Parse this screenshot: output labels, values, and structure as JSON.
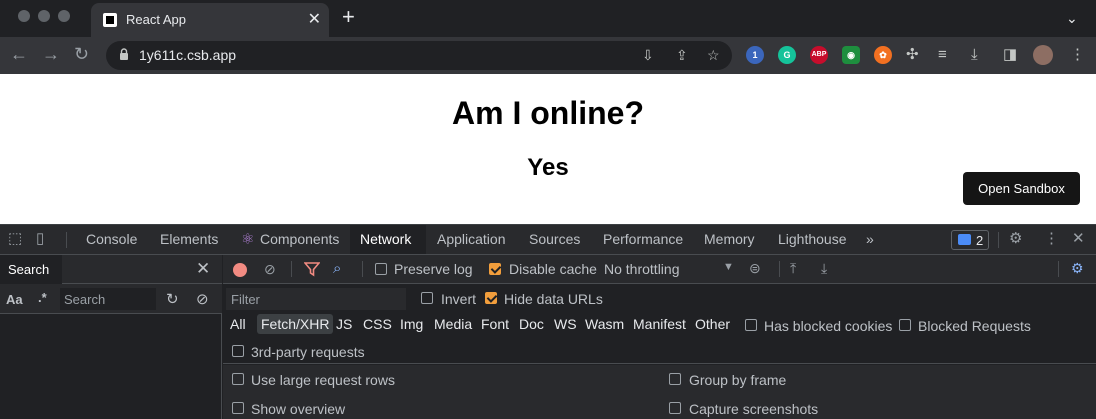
{
  "browser": {
    "tab_title": "React App",
    "url": "1y611c.csb.app",
    "extensions": [
      {
        "name": "1password-icon",
        "glyph": "1",
        "color": "#ffffff",
        "bg": "#3b66bc"
      },
      {
        "name": "grammarly-icon",
        "glyph": "G",
        "color": "#ffffff",
        "bg": "#15c39a"
      },
      {
        "name": "adblock-plus-icon",
        "glyph": "ABP",
        "color": "#ffffff",
        "bg": "#c70d2c"
      },
      {
        "name": "frog-extension-icon",
        "glyph": "◉",
        "color": "#ffffff",
        "bg": "#1e8e3e"
      },
      {
        "name": "squirrel-extension-icon",
        "glyph": "✿",
        "color": "#ffffff",
        "bg": "#f27021"
      }
    ]
  },
  "page": {
    "heading": "Am I online?",
    "status": "Yes",
    "open_sandbox": "Open Sandbox"
  },
  "devtools": {
    "tabs": [
      "Console",
      "Elements",
      "Components",
      "Network",
      "Application",
      "Sources",
      "Performance",
      "Memory",
      "Lighthouse"
    ],
    "active_tab": "Network",
    "more_tabs": "»",
    "issues_count": "2",
    "search_panel": {
      "title": "Search",
      "aa": "Aa",
      "regex": ".*",
      "placeholder": "Search"
    },
    "network": {
      "preserve_log": "Preserve log",
      "preserve_log_checked": false,
      "disable_cache": "Disable cache",
      "disable_cache_checked": true,
      "throttling": "No throttling",
      "filter_placeholder": "Filter",
      "invert": "Invert",
      "invert_checked": false,
      "hide_data_urls": "Hide data URLs",
      "hide_data_urls_checked": true,
      "types": [
        "All",
        "Fetch/XHR",
        "JS",
        "CSS",
        "Img",
        "Media",
        "Font",
        "Doc",
        "WS",
        "Wasm",
        "Manifest",
        "Other"
      ],
      "active_type": "Fetch/XHR",
      "has_blocked_cookies": "Has blocked cookies",
      "blocked_requests": "Blocked Requests",
      "third_party": "3rd-party requests",
      "large_rows": "Use large request rows",
      "group_by_frame": "Group by frame",
      "show_overview": "Show overview",
      "capture_screenshots": "Capture screenshots"
    }
  },
  "colors": {
    "accent_blue": "#8ab4f8",
    "checkbox_orange": "#f29e3c",
    "record_red": "#f28b82"
  }
}
